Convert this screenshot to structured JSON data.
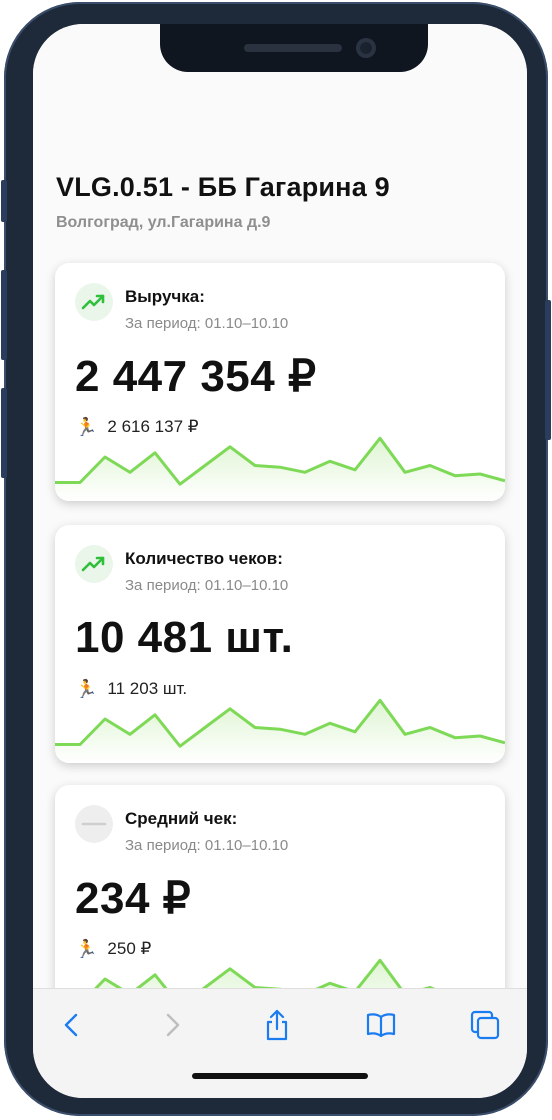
{
  "store": {
    "title": "VLG.0.51 - ББ Гагарина 9",
    "address": "Волгоград, ул.Гагарина д.9"
  },
  "cards": [
    {
      "icon": "trend-up-icon",
      "label": "Выручка:",
      "period": "За период: 01.10–10.10",
      "value": "2 447 354 ₽",
      "previous": "2 616 137 ₽",
      "sparkline": [
        0.1,
        0.1,
        0.4,
        0.22,
        0.45,
        0.08,
        0.3,
        0.52,
        0.3,
        0.28,
        0.22,
        0.35,
        0.25,
        0.62,
        0.22,
        0.3,
        0.18,
        0.2,
        0.12
      ]
    },
    {
      "icon": "trend-up-icon",
      "label": "Количество чеков:",
      "period": "За период: 01.10–10.10",
      "value": "10 481 шт.",
      "previous": "11 203 шт.",
      "sparkline": [
        0.1,
        0.1,
        0.4,
        0.22,
        0.45,
        0.08,
        0.3,
        0.52,
        0.3,
        0.28,
        0.22,
        0.35,
        0.25,
        0.62,
        0.22,
        0.3,
        0.18,
        0.2,
        0.12
      ]
    },
    {
      "icon": "dash-icon",
      "label": "Средний чек:",
      "period": "За период: 01.10–10.10",
      "value": "234 ₽",
      "previous": "250 ₽",
      "sparkline": [
        0.1,
        0.1,
        0.4,
        0.22,
        0.45,
        0.08,
        0.3,
        0.52,
        0.3,
        0.28,
        0.22,
        0.35,
        0.25,
        0.62,
        0.22,
        0.3,
        0.18,
        0.2,
        0.12
      ]
    }
  ],
  "toolbar": [
    "back-icon",
    "forward-icon",
    "share-icon",
    "bookmarks-icon",
    "tabs-icon"
  ],
  "colors": {
    "accent": "#7ed957",
    "fill": "#dff5d3",
    "trend_icon": "#2fbf3a",
    "ios_blue": "#1a7cf0"
  }
}
